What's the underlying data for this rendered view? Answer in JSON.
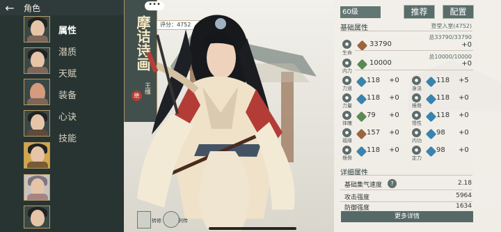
{
  "page_title": "角色",
  "banner": {
    "title": "摩诘诗画",
    "subtitle": "王维",
    "seal": "绝",
    "menu_dots": "•••"
  },
  "score": "评分：4752",
  "tabs": [
    "属性",
    "潜质",
    "天赋",
    "装备",
    "心诀",
    "技能"
  ],
  "header": {
    "level": "60级",
    "recommend": "推荐",
    "config": "配置"
  },
  "basic": {
    "title": "基础属性",
    "ascend": "登堂入室(4752)",
    "hp": {
      "label": "生命",
      "total": "总33790/33790",
      "value": "33790",
      "inc": "+0"
    },
    "inner": {
      "label": "内力",
      "total": "总10000/10000",
      "value": "10000",
      "inc": "+0"
    },
    "grid": [
      {
        "label": "力道",
        "value": "118",
        "inc": "+0",
        "gem": "blue"
      },
      {
        "label": "身法",
        "value": "118",
        "inc": "+5",
        "gem": "blue"
      },
      {
        "label": "力量",
        "value": "118",
        "inc": "+0",
        "gem": "blue"
      },
      {
        "label": "根骨",
        "value": "118",
        "inc": "+0",
        "gem": "blue"
      },
      {
        "label": "体魄",
        "value": "79",
        "inc": "+0",
        "gem": "green"
      },
      {
        "label": "悟性",
        "value": "118",
        "inc": "+0",
        "gem": "blue"
      },
      {
        "label": "福缘",
        "value": "157",
        "inc": "+0",
        "gem": "brown"
      },
      {
        "label": "内功",
        "value": "98",
        "inc": "+0",
        "gem": "blue"
      },
      {
        "label": "根骨",
        "value": "118",
        "inc": "+0",
        "gem": "blue"
      },
      {
        "label": "定力",
        "value": "98",
        "inc": "+0",
        "gem": "blue"
      }
    ]
  },
  "detail": {
    "title": "详细属性",
    "items": [
      {
        "label": "基础集气速度",
        "value": "2.18"
      },
      {
        "label": "攻击强度",
        "value": "5964"
      },
      {
        "label": "防御强度",
        "value": "1634"
      }
    ],
    "more": "更多详情"
  },
  "bottom": {
    "left": "转修",
    "right": "列传"
  }
}
